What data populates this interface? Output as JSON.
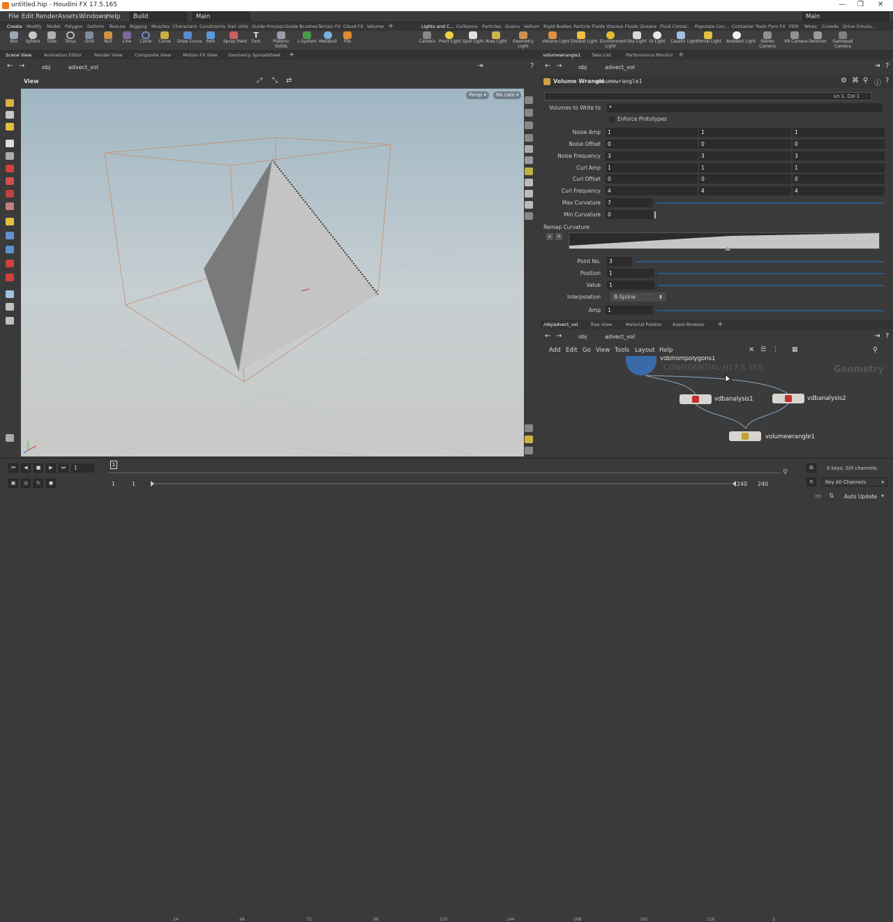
{
  "window": {
    "title": "untitled.hip - Houdini FX 17.5.165"
  },
  "menubar": {
    "items": [
      "File",
      "Edit",
      "Render",
      "Assets",
      "Windows",
      "Help"
    ],
    "desktop": "Build",
    "main_combo": "Main",
    "right_combo": "Main"
  },
  "shelf_tabs_left": [
    "Create",
    "Modify",
    "Model",
    "Polygon",
    "Deform",
    "Texture",
    "Rigging",
    "Muscles",
    "Characters",
    "Constraints",
    "Hair Utils",
    "Guide Process",
    "Guide Brushes",
    "Terrain FX",
    "Cloud FX",
    "Volume"
  ],
  "shelf_tabs_right": [
    "Lights and C...",
    "Collisions",
    "Particles",
    "Grains",
    "Vellum",
    "Rigid Bodies",
    "Particle Fluids",
    "Viscous Fluids",
    "Oceans",
    "Fluid Contai...",
    "Populate Con...",
    "Container Tools",
    "Pyro FX",
    "FEM",
    "Wires",
    "Crowds",
    "Drive Simula..."
  ],
  "shelf_tools_left": [
    "Box",
    "Sphere",
    "Tube",
    "Torus",
    "Grid",
    "Null",
    "Line",
    "Circle",
    "Curve",
    "Draw Curve",
    "Path",
    "Spray Paint",
    "Font",
    "Platonic Solids",
    "L-System",
    "Metaball",
    "File"
  ],
  "shelf_tools_right": [
    "Camera",
    "Point Light",
    "Spot Light",
    "Area Light",
    "Geometry Light",
    "Volume Light",
    "Distant Light",
    "Environment Light",
    "Sky Light",
    "GI Light",
    "Caustic Light",
    "Portal Light",
    "Ambient Light",
    "Stereo Camera",
    "VR Camera",
    "Switcher",
    "Gamepad Camera"
  ],
  "left_pane": {
    "tabs": [
      "Scene View",
      "Animation Editor",
      "Render View",
      "Composite View",
      "Motion FX View",
      "Geometry Spreadsheet"
    ],
    "path_root": "obj",
    "path_node": "advect_vol",
    "view_label": "View",
    "persp": "Persp",
    "cam": "No cam"
  },
  "param_pane": {
    "tabs": [
      "volumewrangle1",
      "Take List",
      "Performance Monitor"
    ],
    "path_root": "obj",
    "path_node": "advect_vol",
    "node_type": "Volume Wrangle",
    "node_name": "volumewrangle1",
    "cursor_pos": "Ln 1, Col 1",
    "volumes_label": "Volumes to Write to",
    "volumes_value": "*",
    "enforce_label": "Enforce Prototypes",
    "vec_rows": [
      {
        "label": "Noise Amp",
        "v": [
          "1",
          "1",
          "1"
        ]
      },
      {
        "label": "Noise Offset",
        "v": [
          "0",
          "0",
          "0"
        ]
      },
      {
        "label": "Noise Frequency",
        "v": [
          "3",
          "3",
          "3"
        ]
      },
      {
        "label": "Curl Amp",
        "v": [
          "1",
          "1",
          "1"
        ]
      },
      {
        "label": "Curl Offset",
        "v": [
          "0",
          "0",
          "0"
        ]
      },
      {
        "label": "Curl Frequency",
        "v": [
          "4",
          "4",
          "4"
        ]
      }
    ],
    "max_curv_label": "Max Curvature",
    "max_curv": "7",
    "min_curv_label": "Min Curvature",
    "min_curv": "0",
    "remap_label": "Remap Curvature",
    "point_no_label": "Point No.",
    "point_no": "3",
    "position_label": "Position",
    "position": "1",
    "value_label": "Value",
    "value": "1",
    "interp_label": "Interpolation",
    "interp": "B-Spline",
    "amp_label": "Amp",
    "amp": "1"
  },
  "network_pane": {
    "tabs": [
      "/obj/advect_vol",
      "Tree View",
      "Material Palette",
      "Asset Browser"
    ],
    "path_root": "obj",
    "path_node": "advect_vol",
    "menu": [
      "Add",
      "Edit",
      "Go",
      "View",
      "Tools",
      "Layout",
      "Help"
    ],
    "watermark": "CONFIDENTIAL H17.5.165",
    "context": "Geometry",
    "nodes": [
      "vdbfrompolygons1",
      "vdbanalysis1",
      "vdbanalysis2",
      "volumewrangle1"
    ]
  },
  "timeline": {
    "frame": "1",
    "ticks": [
      "24",
      "48",
      "72",
      "96",
      "120",
      "144",
      "168",
      "192",
      "216",
      "2"
    ],
    "start1": "1",
    "start2": "1",
    "end1": "240",
    "end2": "240",
    "keys": "0 keys, 0/0 channels",
    "key_all": "Key All Channels",
    "auto_update": "Auto Update"
  }
}
